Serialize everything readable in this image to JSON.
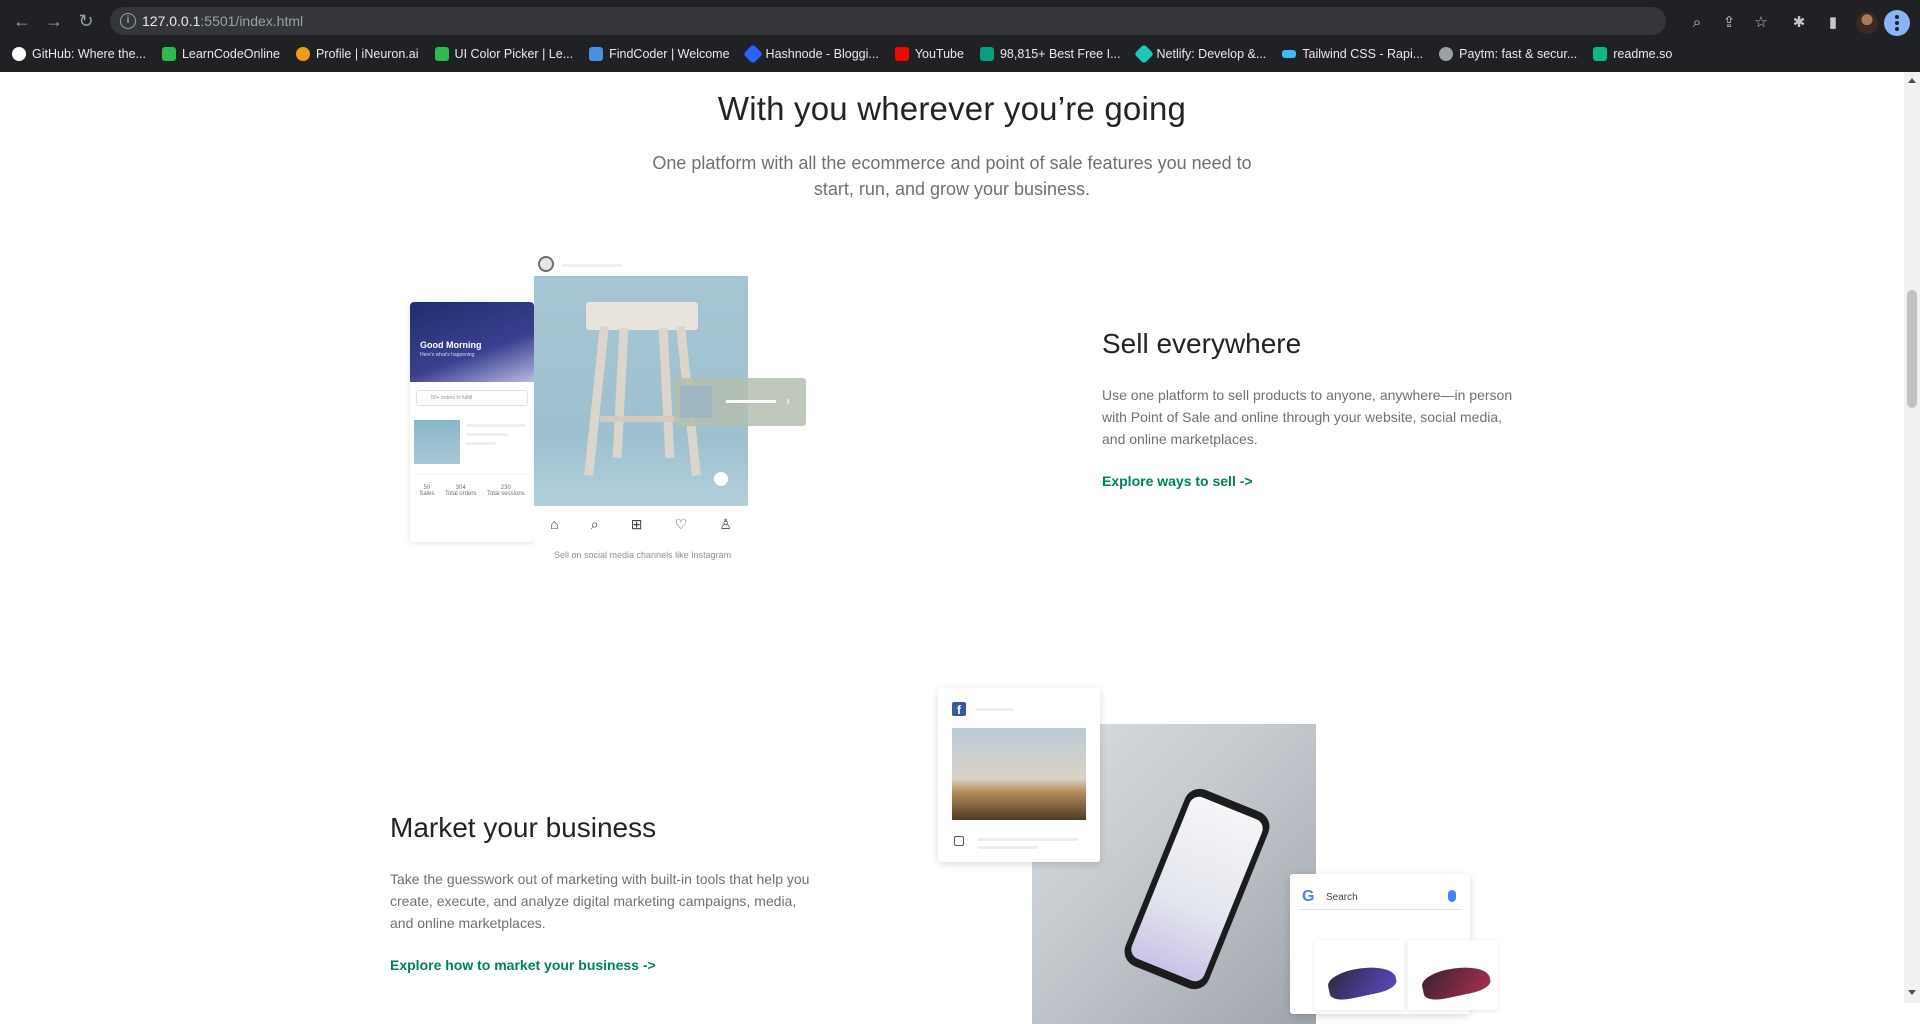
{
  "browser": {
    "url_host": "127.0.0.1",
    "url_rest": ":5501/index.html",
    "bookmarks": [
      {
        "label": "GitHub: Where the...",
        "color": "#ffffff"
      },
      {
        "label": "LearnCodeOnline",
        "color": "#2dbb4f"
      },
      {
        "label": "Profile | iNeuron.ai",
        "color": "#f39c12"
      },
      {
        "label": "UI Color Picker | Le...",
        "color": "#2dbb4f"
      },
      {
        "label": "FindCoder | Welcome",
        "color": "#4a90e2"
      },
      {
        "label": "Hashnode - Bloggi...",
        "color": "#2962ff"
      },
      {
        "label": "YouTube",
        "color": "#ff0000"
      },
      {
        "label": "98,815+ Best Free I...",
        "color": "#05a081"
      },
      {
        "label": "Netlify: Develop &...",
        "color": "#20c6b7"
      },
      {
        "label": "Tailwind CSS - Rapi...",
        "color": "#38bdf8"
      },
      {
        "label": "Paytm: fast & secur...",
        "color": "#9aa0a6"
      },
      {
        "label": "readme.so",
        "color": "#10b981"
      }
    ]
  },
  "hero": {
    "title": "With you wherever you’re going",
    "subtitle": "One platform with all the ecommerce and point of sale features you need to start, run, and grow your business."
  },
  "sell": {
    "title": "Sell everywhere",
    "body": "Use one platform to sell products to anyone, anywhere—in person with Point of Sale and online through your website, social media, and online marketplaces.",
    "link": "Explore ways to sell ->",
    "illustration": {
      "greeting": "Good Morning",
      "greeting_sub": "Here's what's happening",
      "search": "50+ orders to fulfill",
      "stats": [
        {
          "value": "50",
          "label": "Sales"
        },
        {
          "value": "304",
          "label": "Total orders"
        },
        {
          "value": "230",
          "label": "Total sessions"
        }
      ],
      "caption": "Sell on social media channels like Instagram"
    }
  },
  "market": {
    "title": "Market your business",
    "body": "Take the guesswork out of marketing with built-in tools that help you create, execute, and analyze digital marketing campaigns, media, and online marketplaces.",
    "link": "Explore how to market your business ->",
    "illustration": {
      "fb_logo": "f",
      "google_logo": "G",
      "search": "Search"
    }
  },
  "colors": {
    "accent": "#008060",
    "heading": "#212326",
    "body": "#6d7175",
    "chrome": "#202124"
  }
}
